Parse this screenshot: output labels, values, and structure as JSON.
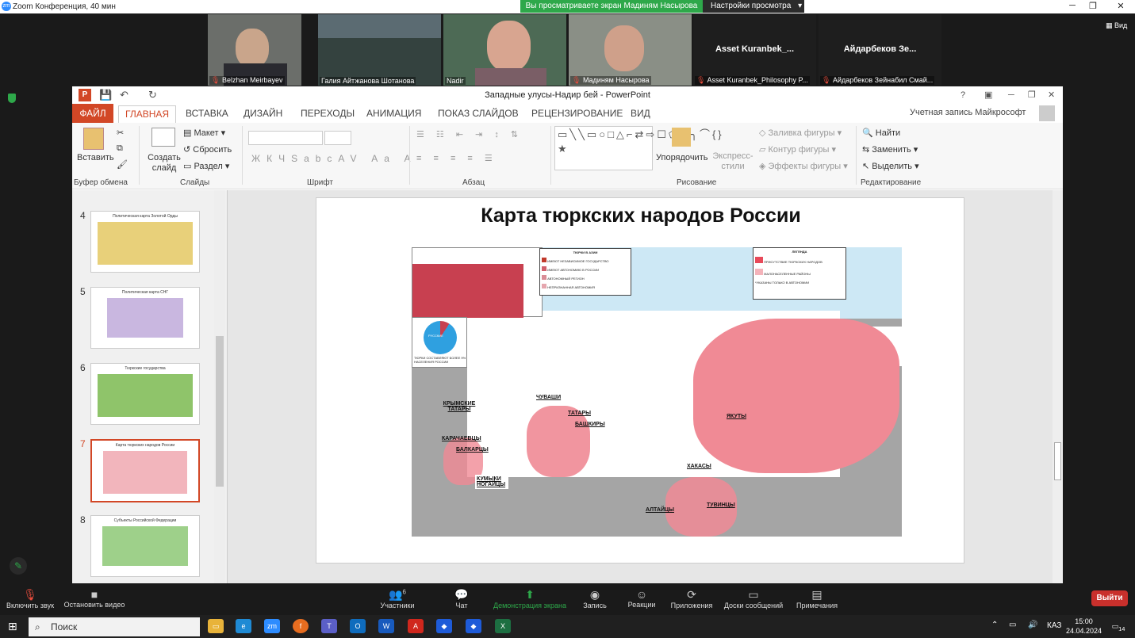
{
  "zoom": {
    "window_title": "Zoom Конференция, 40 мин",
    "share_banner": "Вы просматриваете экран Мадиням Насырова",
    "view_settings": "Настройки просмотра",
    "view_btn": "Вид",
    "participants": [
      {
        "name": "Belzhan Meirbayev"
      },
      {
        "name": "Галия Айтжанова Шотанова"
      },
      {
        "name": "Nadir"
      },
      {
        "name": "Мадиням Насырова"
      },
      {
        "name": "Asset Kuranbek_Philosophy P...",
        "big": "Asset  Kuranbek_..."
      },
      {
        "name": "Айдарбеков Зейнабил Смай...",
        "big": "Айдарбеков  Зе..."
      }
    ],
    "toolbar": {
      "mute": "Включить звук",
      "video": "Остановить видео",
      "participants": "Участники",
      "participants_count": "6",
      "chat": "Чат",
      "share": "Демонстрация экрана",
      "record": "Запись",
      "reactions": "Реакции",
      "apps": "Приложения",
      "whiteboards": "Доски сообщений",
      "notes": "Примечания",
      "leave": "Выйти"
    }
  },
  "ppt": {
    "title": "Западные улусы-Надир бей - PowerPoint",
    "account": "Учетная запись Майкрософт",
    "tabs": [
      "ФАЙЛ",
      "ГЛАВНАЯ",
      "ВСТАВКА",
      "ДИЗАЙН",
      "ПЕРЕХОДЫ",
      "АНИМАЦИЯ",
      "ПОКАЗ СЛАЙДОВ",
      "РЕЦЕНЗИРОВАНИЕ",
      "ВИД"
    ],
    "ribbon": {
      "paste": "Вставить",
      "clipboard": "Буфер обмена",
      "new_slide": "Создать слайд",
      "layout": "Макет",
      "reset": "Сбросить",
      "section": "Раздел",
      "slides": "Слайды",
      "font": "Шрифт",
      "paragraph": "Абзац",
      "arrange": "Упорядочить",
      "quick_styles": "Экспресс-стили",
      "fill": "Заливка фигуры",
      "outline": "Контур фигуры",
      "effects": "Эффекты фигуры",
      "drawing": "Рисование",
      "find": "Найти",
      "replace": "Заменить",
      "select": "Выделить",
      "editing": "Редактирование"
    },
    "slides": [
      {
        "num": "4",
        "title": "Политическая карта Золотой Орды"
      },
      {
        "num": "5",
        "title": "Политическая карта СНГ"
      },
      {
        "num": "6",
        "title": "Тюркские государства"
      },
      {
        "num": "7",
        "title": "Карта тюркских народов России"
      },
      {
        "num": "8",
        "title": "Субъекты Российской Федерации"
      }
    ],
    "slide": {
      "title": "Карта тюркских народов России",
      "legend_asia_title": "ТЮРКИ В АЗИИ",
      "legend_asia": [
        "ИМЕЮТ НЕЗАВИСИМОЕ ГОСУДАРСТВО",
        "ИМЕЮТ АВТОНОМИЮ В РОССИИ",
        "АВТОНОМНЫЙ РЕГИОН",
        "НЕПРИЗНАННАЯ АВТОНОМИЯ"
      ],
      "legend_title": "ЛЕГЕНДА",
      "legend": [
        "ПРИСУТСТВИЕ ТЮРКСКИХ НАРОДОВ",
        "МАЛОНАСЕЛЕННЫЕ РАЙОНЫ",
        "*УКАЗАНЫ ТОЛЬКО В АВТОНОМИИ"
      ],
      "pie_label": "РУССКИЕ",
      "pie_caption": "ТЮРКИ СОСТАВЛЯЮТ БОЛЕЕ 9% НАСЕЛЕНИЯ РОССИИ",
      "labels": [
        "ЧУВАШИ",
        "ТАТАРЫ",
        "БАШКИРЫ",
        "КРЫМСКИЕ ТАТАРЫ",
        "КАРАЧАЕВЦЫ",
        "БАЛКАРЦЫ",
        "КУМЫКИ НОГАЙЦЫ",
        "ЯКУТЫ",
        "ХАКАСЫ",
        "АЛТАЙЦЫ",
        "ТУВИНЦЫ"
      ]
    }
  },
  "taskbar": {
    "search": "Поиск",
    "lang": "КАЗ",
    "time": "15:00",
    "date": "24.04.2024",
    "notif": "14"
  },
  "colors": {
    "ppt_accent": "#d24726",
    "zoom_green": "#2ea84a",
    "leave_red": "#c9302c",
    "turkic_red": "#f08a95"
  }
}
